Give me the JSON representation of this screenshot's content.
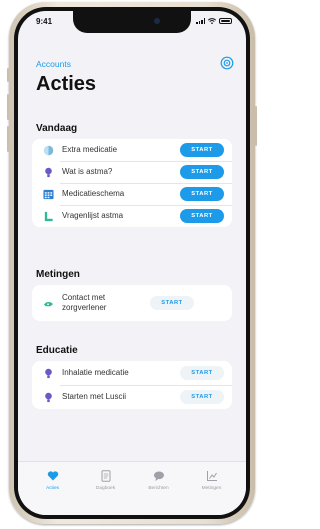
{
  "status_bar": {
    "time": "9:41"
  },
  "header": {
    "back_label": "Accounts",
    "title": "Acties",
    "settings_icon": "settings-icon"
  },
  "sections": {
    "today": {
      "title": "Vandaag",
      "items": [
        {
          "label": "Extra medicatie",
          "icon": "medication-icon",
          "button": "START"
        },
        {
          "label": "Wat is astma?",
          "icon": "lightbulb-icon",
          "button": "START"
        },
        {
          "label": "Medicatieschema",
          "icon": "calendar-icon",
          "button": "START"
        },
        {
          "label": "Vragenlijst astma",
          "icon": "questionnaire-icon",
          "button": "START"
        }
      ]
    },
    "measurements": {
      "title": "Metingen",
      "items": [
        {
          "label": "Contact met zorgverlener",
          "icon": "contact-icon",
          "button": "START"
        }
      ]
    },
    "education": {
      "title": "Educatie",
      "items": [
        {
          "label": "Inhalatie medicatie",
          "icon": "lightbulb-icon",
          "button": "START"
        },
        {
          "label": "Starten met Luscii",
          "icon": "lightbulb-icon",
          "button": "START"
        }
      ]
    }
  },
  "tab_bar": {
    "tabs": [
      {
        "label": "Acties",
        "icon": "heart-icon",
        "active": true
      },
      {
        "label": "Dagboek",
        "icon": "journal-icon",
        "active": false
      },
      {
        "label": "Berichten",
        "icon": "messages-icon",
        "active": false
      },
      {
        "label": "Metingen",
        "icon": "chart-icon",
        "active": false
      }
    ]
  },
  "colors": {
    "accent": "#1e9be8",
    "background": "#f2f2f7",
    "card": "#ffffff",
    "lightbulb": "#6e58c9",
    "calendar": "#2f7fd1",
    "questionnaire": "#2fb89a"
  }
}
